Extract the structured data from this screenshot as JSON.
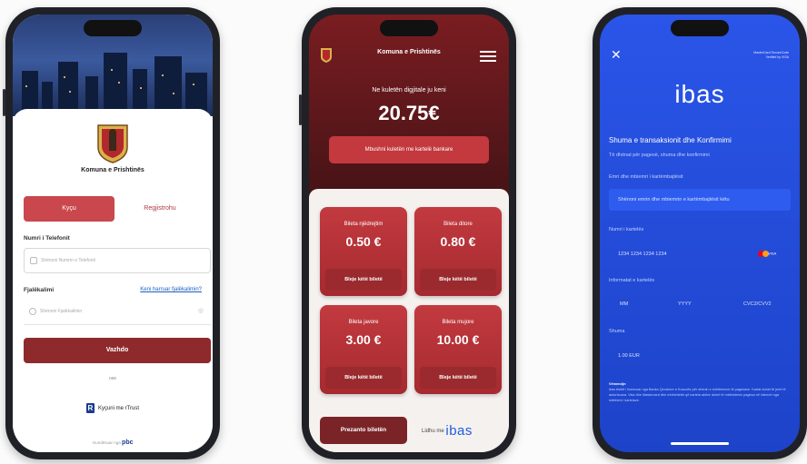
{
  "phone1": {
    "municipality": "Komuna e Prishtinës",
    "tab_login": "Kyçu",
    "tab_register": "Regjistrohu",
    "phone_label": "Numri i Telefonit",
    "phone_placeholder": "Shënoni Numrin e Telefonit",
    "password_label": "Fjalëkalimi",
    "forgot_link": "Keni harruar fjalëkalimin?",
    "password_placeholder": "Shënoni Fjalëkalimin",
    "continue_button": "Vazhdo",
    "or_text": "ose",
    "rtrust_button": "Kyçuni me rTrust",
    "powered_by_prefix": "mundësuar nga",
    "powered_by_brand": "pbc"
  },
  "phone2": {
    "municipality": "Komuna e Prishtinës",
    "wallet_text": "Ne kuletën digjitale ju keni",
    "balance": "20.75€",
    "topup_button": "Mbushni kuletën me kartelë bankare",
    "tickets": [
      {
        "name": "Bileta njëdrejtim",
        "price": "0.50 €",
        "buy": "Bleje këtë biletë"
      },
      {
        "name": "Bileta ditore",
        "price": "0.80 €",
        "buy": "Bleje këtë biletë"
      },
      {
        "name": "Bileta javore",
        "price": "3.00 €",
        "buy": "Bleje këtë biletë"
      },
      {
        "name": "Bileta mujore",
        "price": "10.00 €",
        "buy": "Bleje këtë biletë"
      }
    ],
    "present_button": "Prezanto biletën",
    "link_prefix": "Lidhu me",
    "link_brand": "ibas"
  },
  "phone3": {
    "close": "✕",
    "brands": [
      "MasterCard SecureCode",
      "Verified by VISA"
    ],
    "logo": "ibas",
    "section_title": "Shuma e transaksionit dhe Konfirmimi",
    "intro": "Të dhënat për pagesë, shuma dhe konfirmimi",
    "name_label": "Emri dhe mbiemri i kartëmbajtësit",
    "name_placeholder": "Shënoni emrin dhe mbiemrin e kartëmbajtësit këtu",
    "card_label": "Numri i kartelës",
    "card_value": "1234 1234 1234 1234",
    "card_type": "VISA",
    "card_info_label": "Informatat e kartelës",
    "mm": "MM",
    "yyyy": "YYYY",
    "cvc": "CVC2/CVV2",
    "amount_label": "Shuma",
    "amount_value": "1.00 EUR",
    "note_title": "Vëmendje:",
    "note_text": "ibas është i licencuar nga Banka Qendrore e Kosovës për ofrimin e shërbimeve të pagesave. Kartat duhet të jenë të autorizuara. Visa dhe Mastercard dhe mbështetet që kartela aktive duhet të mbështesin pagesa në internet nga shërbimi i kartelave."
  }
}
